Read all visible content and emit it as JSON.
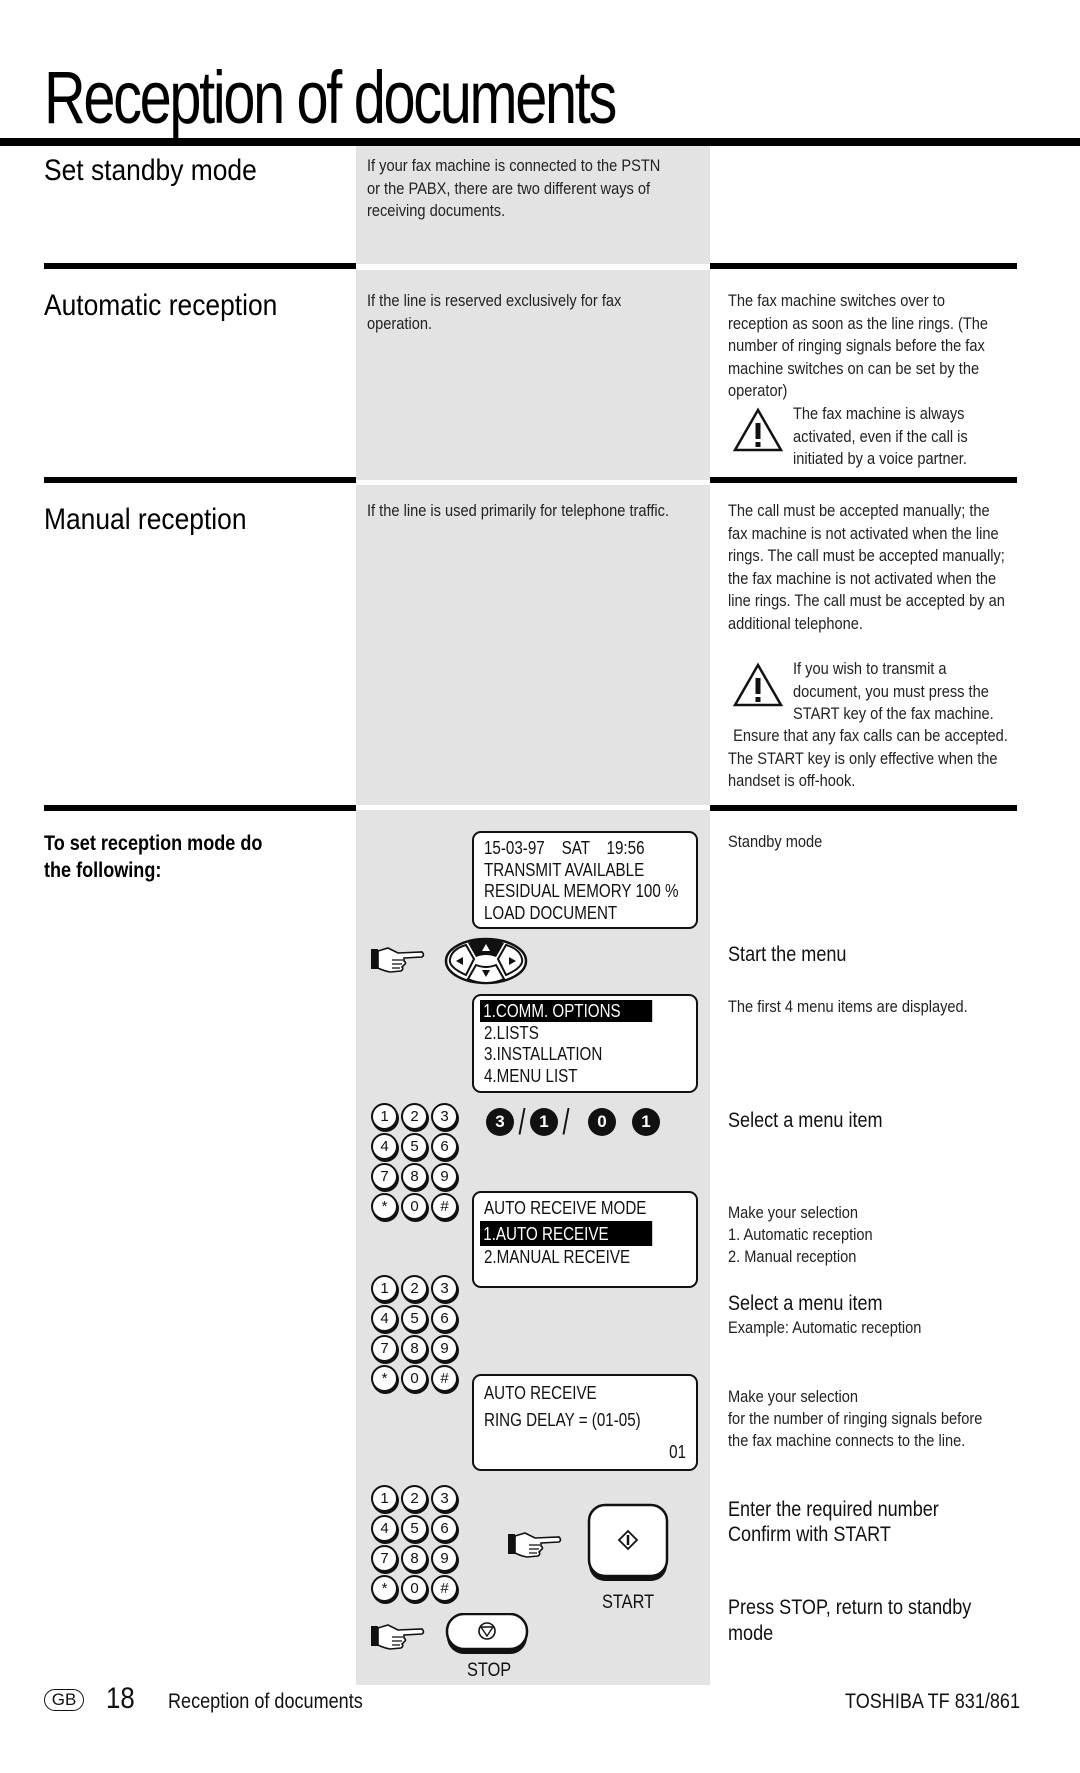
{
  "page": {
    "title": "Reception of documents"
  },
  "sections": {
    "standby": {
      "heading": "Set standby mode",
      "middle": "If your fax machine is connected to the PSTN or the PABX, there are two different ways of receiving documents."
    },
    "automatic": {
      "heading": "Automatic reception",
      "middle": "If the line is reserved exclusively for fax operation.",
      "right": "The fax machine switches over to reception as soon as the line rings. (The number of ringing signals before the fax machine switches on can be set by the operator)",
      "warning": "The fax machine is always activated, even if the call is initiated by a voice partner."
    },
    "manual": {
      "heading": "Manual reception",
      "middle": "If the line is used primarily for telephone traffic.",
      "right": "The call must be accepted manually; the fax machine is not activated when the line rings. The call must be accepted manually; the fax machine is not activated when the line rings. The call must be accepted by an additional telephone.",
      "warning": "If you wish to transmit a document, you must press the START key of the fax machine.",
      "after_warning": "Ensure that any fax calls can be accepted. The START key is only effective when the handset is off-hook."
    }
  },
  "procedure": {
    "instruction": "To set reception mode do the following:",
    "lcd_standby": [
      "15-03-97    SAT    19:56",
      "TRANSMIT AVAILABLE",
      "RESIDUAL MEMORY 100 %",
      "LOAD DOCUMENT"
    ],
    "lcd_menu": {
      "selected": "1.COMM. OPTIONS",
      "items": [
        "2.LISTS",
        "3.INSTALLATION",
        "4.MENU LIST"
      ]
    },
    "sequence": [
      "3",
      "/",
      "1",
      "/",
      "0",
      "1"
    ],
    "lcd_auto_mode": {
      "title": "AUTO RECEIVE MODE",
      "selected": "1.AUTO RECEIVE",
      "items": [
        "2.MANUAL RECEIVE"
      ]
    },
    "lcd_ring_delay": {
      "line1": "AUTO RECEIVE",
      "line2": "RING DELAY = (01-05)",
      "value": "01"
    },
    "keypad_keys": [
      "1",
      "2",
      "3",
      "4",
      "5",
      "6",
      "7",
      "8",
      "9",
      "*",
      "0",
      "#"
    ],
    "start_label": "START",
    "stop_label": "STOP",
    "steps": {
      "standby_mode": "Standby mode",
      "start_menu": "Start the menu",
      "first_items": "The first 4 menu items are displayed.",
      "select_item_1": "Select a menu item",
      "make_selection_1": "Make your selection",
      "option_1": "1. Automatic reception",
      "option_2": "2. Manual reception",
      "select_item_2": "Select a menu item",
      "example": "Example: Automatic reception",
      "make_selection_2": "Make your selection",
      "ring_note_1": "for the number of ringing signals before",
      "ring_note_2": "the fax machine connects to the line.",
      "enter_number": "Enter the required number",
      "confirm_start": "Confirm with START",
      "press_stop_1": "Press STOP, return to standby",
      "press_stop_2": "mode"
    }
  },
  "footer": {
    "country": "GB",
    "page_number": "18",
    "section": "Reception of documents",
    "model": "TOSHIBA  TF 831/861"
  }
}
